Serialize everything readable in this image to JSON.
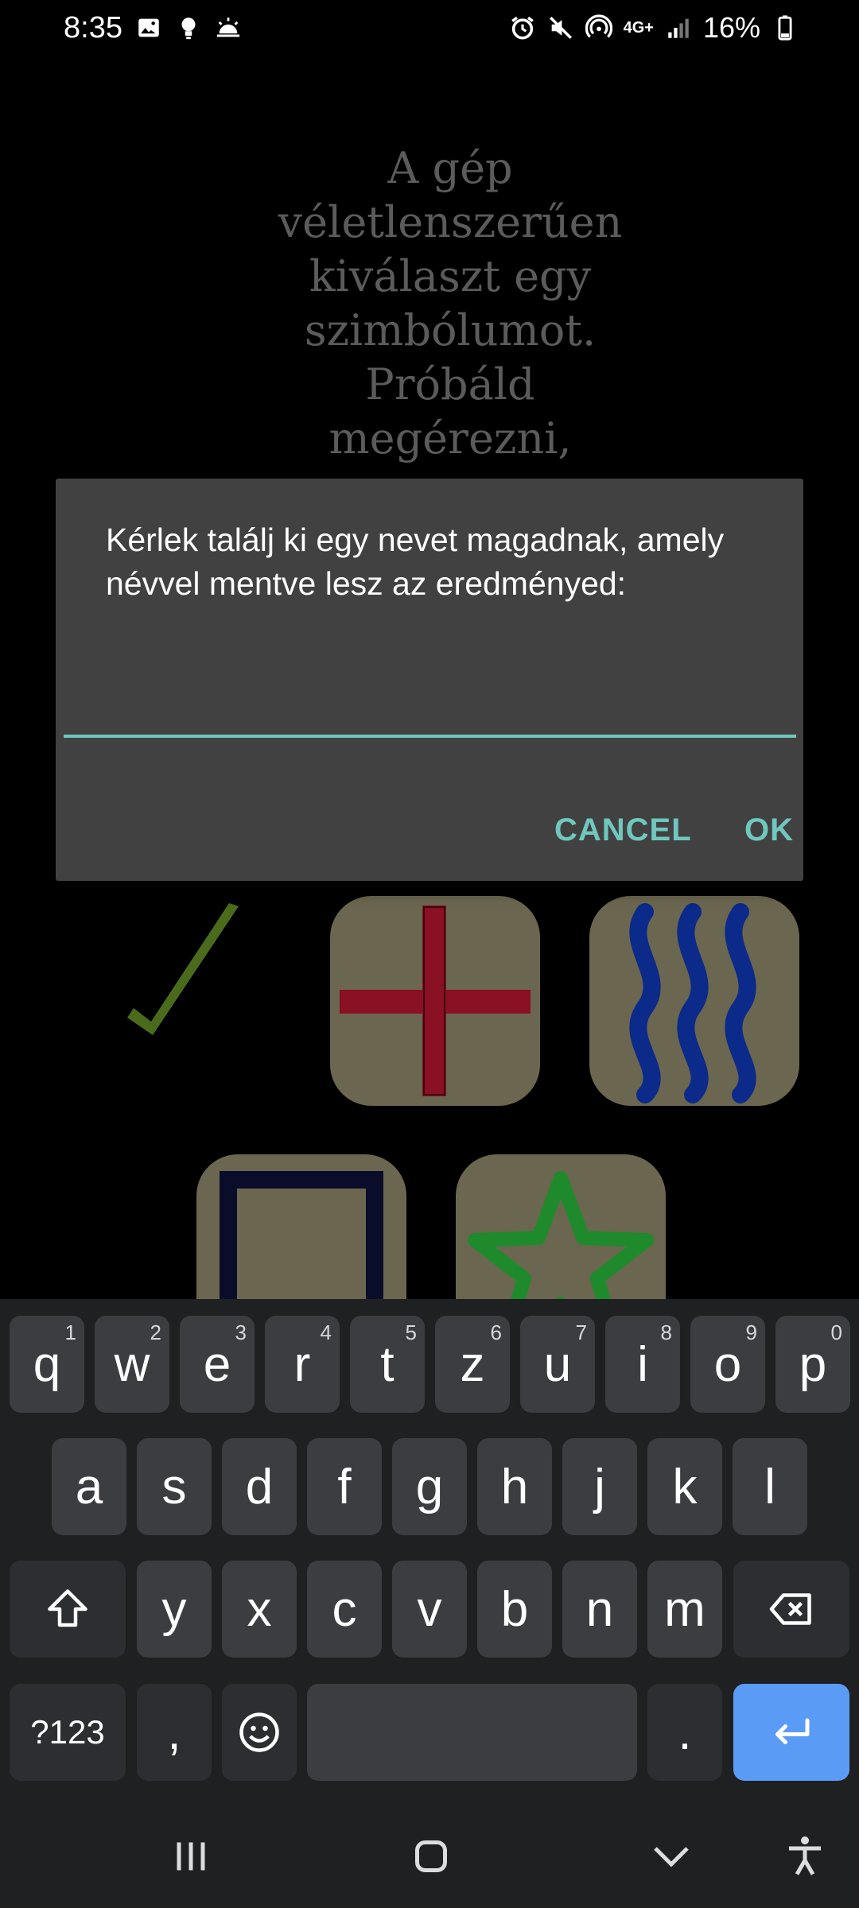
{
  "status_bar": {
    "time": "8:35",
    "battery": "16%",
    "network": "4G+"
  },
  "background": {
    "instructions_lines": [
      "A gép",
      "véletlenszerűen",
      "kiválaszt egy",
      "szimbólumot.",
      "Próbáld",
      "megérezni,"
    ],
    "symbols": [
      "check",
      "plus",
      "waves",
      "square",
      "star"
    ]
  },
  "dialog": {
    "message": "Kérlek találj ki egy nevet magadnak, amely névvel mentve lesz az eredményed:",
    "input_value": "",
    "cancel_label": "CANCEL",
    "ok_label": "OK"
  },
  "keyboard": {
    "row1": [
      {
        "char": "q",
        "hint": "1"
      },
      {
        "char": "w",
        "hint": "2"
      },
      {
        "char": "e",
        "hint": "3"
      },
      {
        "char": "r",
        "hint": "4"
      },
      {
        "char": "t",
        "hint": "5"
      },
      {
        "char": "z",
        "hint": "6"
      },
      {
        "char": "u",
        "hint": "7"
      },
      {
        "char": "i",
        "hint": "8"
      },
      {
        "char": "o",
        "hint": "9"
      },
      {
        "char": "p",
        "hint": "0"
      }
    ],
    "row2": [
      "a",
      "s",
      "d",
      "f",
      "g",
      "h",
      "j",
      "k",
      "l"
    ],
    "row3": [
      "y",
      "x",
      "c",
      "v",
      "b",
      "n",
      "m"
    ],
    "symbols_label": "?123",
    "comma_label": ",",
    "period_label": "."
  },
  "colors": {
    "accent": "#6fc7bd",
    "dialog_bg": "#414141",
    "enter_key": "#5a9cf5"
  }
}
